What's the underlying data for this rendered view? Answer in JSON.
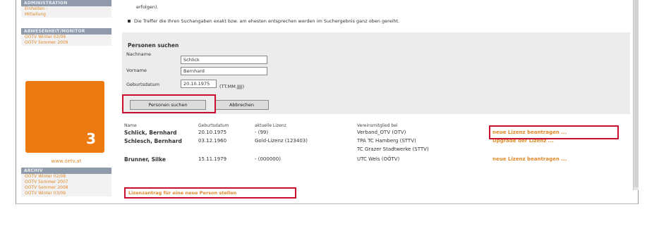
{
  "sidebar": {
    "sections": [
      {
        "heading": "ADMINISTRATION",
        "links": [
          "Einheiten -",
          "Mitteilung"
        ]
      },
      {
        "heading": "ABWESENHEIT/MONITOR",
        "links": [
          "OÖTV Winter 02/09",
          "OÖTV Sommer 2009"
        ]
      },
      {
        "heading": "ARCHIV",
        "links": [
          "OÖTV Winter 02/08",
          "OÖTV Sommer 2007",
          "OÖTV Sommer 2008",
          "OÖTV Winter 03/09"
        ]
      }
    ],
    "promo_number": "3",
    "url": "www.oetv.at"
  },
  "content": {
    "intro_line_1": "erfolgen).",
    "intro_line_2": "Die Treffer die Ihren Suchangaben exakt bzw. am ehesten entsprechen werden im Suchergebnis ganz oben gereiht.",
    "search_title": "Personen suchen",
    "fields": {
      "lastname_label": "Nachname",
      "lastname_value": "Schlick",
      "firstname_label": "Vorname",
      "firstname_value": "Bernhard",
      "birthdate_label": "Geburtsdatum",
      "birthdate_value": "20.10.1975",
      "birthdate_hint": "(TT.MM.JJJJ)"
    },
    "search_button": "Personen suchen",
    "cancel_button": "Abbrechen",
    "table": {
      "headers": [
        "Name",
        "Geburtsdatum",
        "aktuelle Lizenz",
        "Vereinsmitglied bei",
        ""
      ],
      "rows": [
        {
          "name": "Schlick, Bernhard",
          "birth": "20.10.1975",
          "license": "- (99)",
          "club": "Verband_OTV (OTV)",
          "club2": "",
          "action": "neue Lizenz beantragen ..."
        },
        {
          "name": "Schlesch, Bernhard",
          "birth": "03.12.1960",
          "license": "Gold-Lizenz (123403)",
          "club": "TPA TC Hamberg (STTV)",
          "club2": "TC Grazer Stadtwerke (STTV)",
          "action": "Upgrade der Lizenz ..."
        },
        {
          "name": "Brunner, Silke",
          "birth": "15.11.1979",
          "license": "- (000000)",
          "club": "UTC Wels (OÖTV)",
          "club2": "",
          "action": "neue Lizenz beantragen ..."
        }
      ]
    },
    "new_person_link": "Lizenzantrag für eine neue Person stellen"
  },
  "colors": {
    "accent_orange": "#ec7a10",
    "link_orange": "#e08a2c",
    "highlight_red": "#c8102e",
    "sidebar_heading": "#8f9aaa"
  }
}
